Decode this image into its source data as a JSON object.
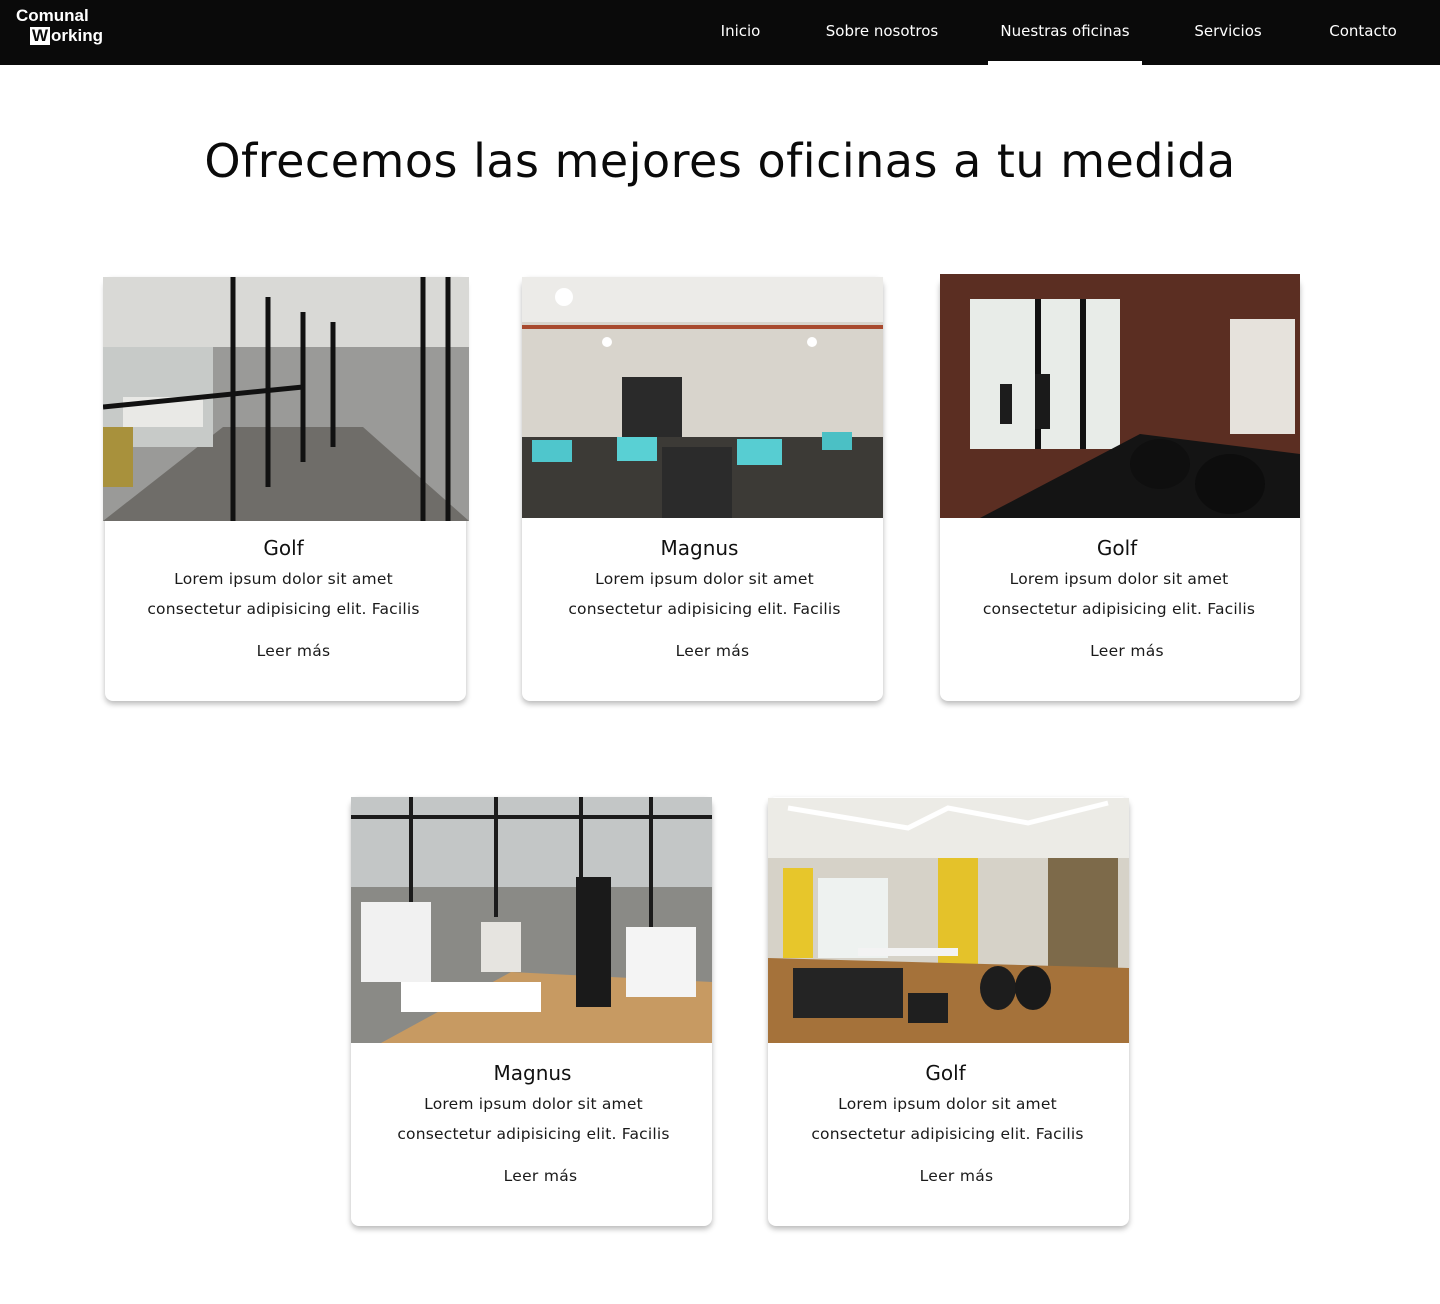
{
  "brand": {
    "line1": "Comunal",
    "line2_initial": "W",
    "line2_rest": "orking"
  },
  "nav": {
    "items": [
      {
        "label": "Inicio"
      },
      {
        "label": "Sobre nosotros"
      },
      {
        "label": "Nuestras oficinas",
        "active": true
      },
      {
        "label": "Servicios"
      },
      {
        "label": "Contacto"
      }
    ]
  },
  "main": {
    "title": "Ofrecemos las mejores oficinas a tu medida",
    "cards": [
      {
        "title": "Golf",
        "desc_line1": "Lorem ipsum dolor sit amet",
        "desc_line2": "consectetur adipisicing elit. Facilis",
        "link": "Leer más",
        "image": "glass-corridor-office-photo"
      },
      {
        "title": "Magnus",
        "desc_line1": "Lorem ipsum dolor sit amet",
        "desc_line2": "consectetur adipisicing elit. Facilis",
        "link": "Leer más",
        "image": "open-plan-office-photo"
      },
      {
        "title": "Golf",
        "desc_line1": "Lorem ipsum dolor sit amet",
        "desc_line2": "consectetur adipisicing elit. Facilis",
        "link": "Leer más",
        "image": "brick-wall-desks-photo"
      },
      {
        "title": "Magnus",
        "desc_line1": "Lorem ipsum dolor sit amet",
        "desc_line2": "consectetur adipisicing elit. Facilis",
        "link": "Leer más",
        "image": "meeting-room-team-photo"
      },
      {
        "title": "Golf",
        "desc_line1": "Lorem ipsum dolor sit amet",
        "desc_line2": "consectetur adipisicing elit. Facilis",
        "link": "Leer más",
        "image": "yellow-lounge-office-photo"
      }
    ]
  },
  "colors": {
    "nav_bg": "#0a0a0a",
    "page_bg": "#ffffff",
    "text": "#111111"
  }
}
